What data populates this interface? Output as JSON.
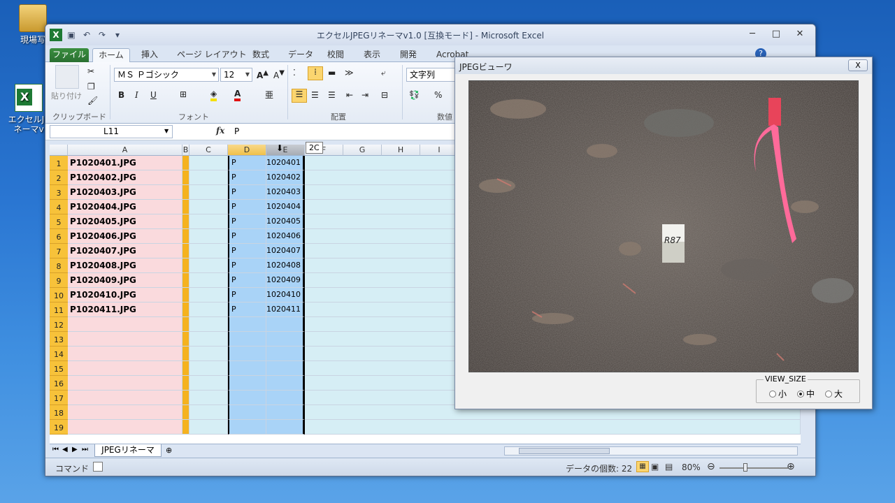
{
  "desktop": {
    "icons": [
      {
        "label": "現場写",
        "type": "folder"
      },
      {
        "label": "エクセルJP\nネーマv",
        "type": "excel"
      }
    ]
  },
  "excel": {
    "title": "エクセルJPEGリネーマv1.0 [互換モード] - Microsoft Excel",
    "tabs": [
      "ファイル",
      "ホーム",
      "挿入",
      "ページ レイアウト",
      "数式",
      "データ",
      "校閲",
      "表示",
      "開発",
      "Acrobat"
    ],
    "ribbon": {
      "paste_label": "貼り付け",
      "clipboard_group": "クリップボード",
      "font_name": "ＭＳ Ｐゴシック",
      "font_size": "12",
      "font_group": "フォント",
      "align_group": "配置",
      "number_format": "文字列",
      "number_group": "数値"
    },
    "name_box": "L11",
    "formula_value": "P",
    "tooltip": "2C",
    "columns": [
      "A",
      "B",
      "C",
      "D",
      "E",
      "F",
      "G",
      "H",
      "I"
    ],
    "rows": [
      {
        "num": "1",
        "a": "P1020401.JPG",
        "d": "P",
        "e": "1020401"
      },
      {
        "num": "2",
        "a": "P1020402.JPG",
        "d": "P",
        "e": "1020402"
      },
      {
        "num": "3",
        "a": "P1020403.JPG",
        "d": "P",
        "e": "1020403"
      },
      {
        "num": "4",
        "a": "P1020404.JPG",
        "d": "P",
        "e": "1020404"
      },
      {
        "num": "5",
        "a": "P1020405.JPG",
        "d": "P",
        "e": "1020405"
      },
      {
        "num": "6",
        "a": "P1020406.JPG",
        "d": "P",
        "e": "1020406"
      },
      {
        "num": "7",
        "a": "P1020407.JPG",
        "d": "P",
        "e": "1020407"
      },
      {
        "num": "8",
        "a": "P1020408.JPG",
        "d": "P",
        "e": "1020408"
      },
      {
        "num": "9",
        "a": "P1020409.JPG",
        "d": "P",
        "e": "1020409"
      },
      {
        "num": "10",
        "a": "P1020410.JPG",
        "d": "P",
        "e": "1020410"
      },
      {
        "num": "11",
        "a": "P1020411.JPG",
        "d": "P",
        "e": "1020411"
      },
      {
        "num": "12",
        "a": "",
        "d": "",
        "e": ""
      },
      {
        "num": "13",
        "a": "",
        "d": "",
        "e": ""
      },
      {
        "num": "14",
        "a": "",
        "d": "",
        "e": ""
      },
      {
        "num": "15",
        "a": "",
        "d": "",
        "e": ""
      },
      {
        "num": "16",
        "a": "",
        "d": "",
        "e": ""
      },
      {
        "num": "17",
        "a": "",
        "d": "",
        "e": ""
      },
      {
        "num": "18",
        "a": "",
        "d": "",
        "e": ""
      },
      {
        "num": "19",
        "a": "",
        "d": "",
        "e": ""
      }
    ],
    "sheet_tab": "JPEGリネーマ",
    "status": {
      "mode": "コマンド",
      "count_label": "データの個数: 22",
      "zoom": "80%"
    }
  },
  "viewer": {
    "title": "JPEGビューワ",
    "close": "X",
    "photo_sign": "R87",
    "view_size_label": "VIEW_SIZE",
    "options": [
      "小",
      "中",
      "大"
    ],
    "selected": "中"
  },
  "colors": {
    "header_orange": "#f7c23a",
    "col_a_pink": "#fadadd",
    "col_b_orange": "#f5b21f",
    "col_d_blue": "#a9d3f7",
    "other_cyan": "#d6eef5",
    "excel_green": "#2a7031"
  }
}
